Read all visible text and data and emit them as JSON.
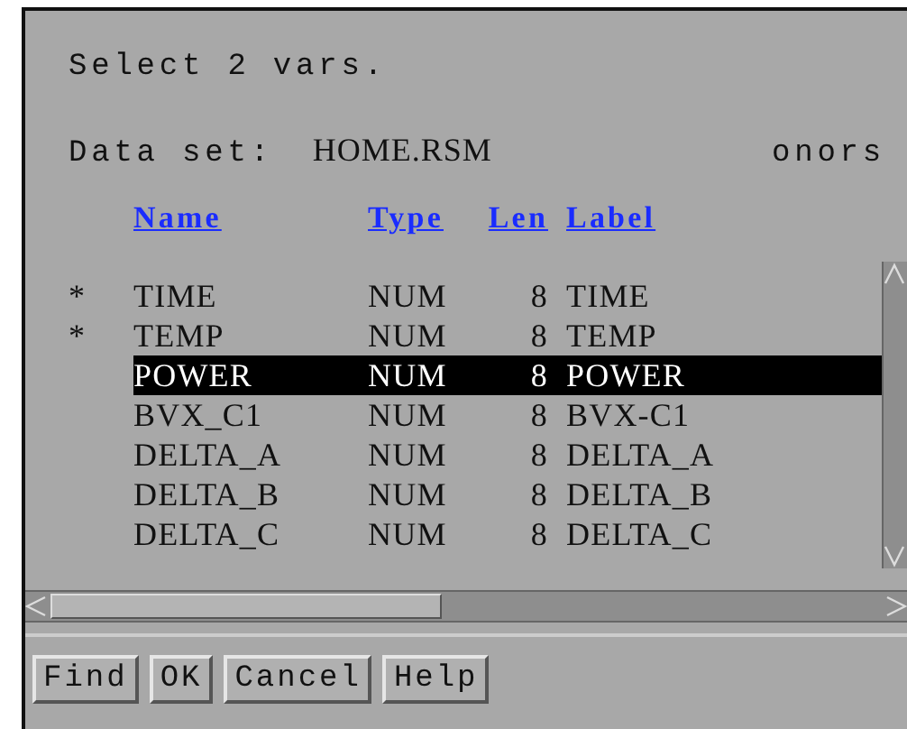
{
  "prompt": "Select 2 vars.",
  "data_set": {
    "label": "Data set:",
    "value": "HOME.RSM",
    "extra": "onors"
  },
  "columns": [
    "Name",
    "Type",
    "Len",
    "Label"
  ],
  "rows": [
    {
      "marked": true,
      "selected": false,
      "name": "TIME",
      "type": "NUM",
      "len": "8",
      "label": "TIME"
    },
    {
      "marked": true,
      "selected": false,
      "name": "TEMP",
      "type": "NUM",
      "len": "8",
      "label": "TEMP"
    },
    {
      "marked": false,
      "selected": true,
      "name": "POWER",
      "type": "NUM",
      "len": "8",
      "label": "POWER"
    },
    {
      "marked": false,
      "selected": false,
      "name": "BVX_C1",
      "type": "NUM",
      "len": "8",
      "label": "BVX-C1"
    },
    {
      "marked": false,
      "selected": false,
      "name": "DELTA_A",
      "type": "NUM",
      "len": "8",
      "label": "DELTA_A"
    },
    {
      "marked": false,
      "selected": false,
      "name": "DELTA_B",
      "type": "NUM",
      "len": "8",
      "label": "DELTA_B"
    },
    {
      "marked": false,
      "selected": false,
      "name": "DELTA_C",
      "type": "NUM",
      "len": "8",
      "label": "DELTA_C"
    }
  ],
  "mark_symbol": "*",
  "buttons": [
    "Find",
    "OK",
    "Cancel",
    "Help"
  ]
}
